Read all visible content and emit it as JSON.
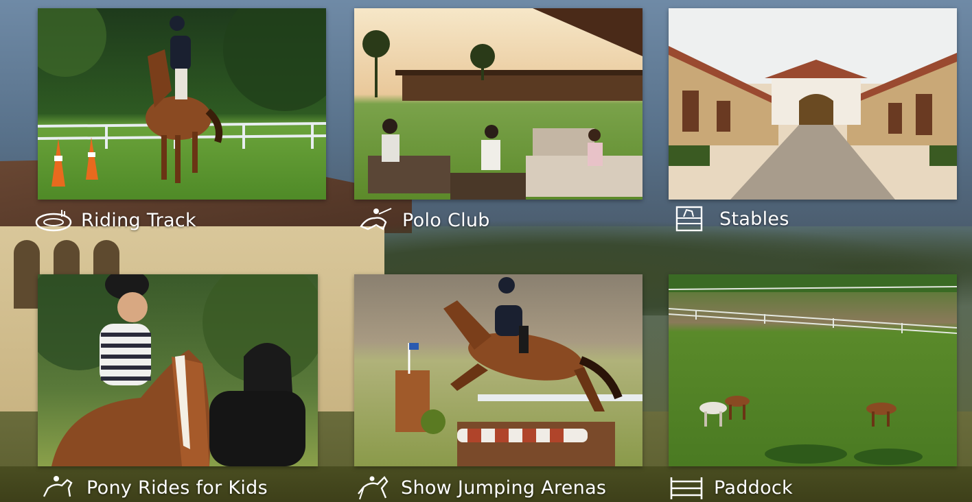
{
  "tiles": [
    {
      "label": "Riding Track",
      "icon": "riding-track-icon"
    },
    {
      "label": "Polo Club",
      "icon": "polo-player-icon"
    },
    {
      "label": "Stables",
      "icon": "stable-icon"
    },
    {
      "label": "Pony Rides for Kids",
      "icon": "pony-icon"
    },
    {
      "label": "Show Jumping Arenas",
      "icon": "jumping-horse-icon"
    },
    {
      "label": "Paddock",
      "icon": "fence-icon"
    }
  ],
  "colors": {
    "label_text": "#ffffff",
    "grass": "#5c8a2a",
    "bay_horse": "#8a4a22"
  }
}
